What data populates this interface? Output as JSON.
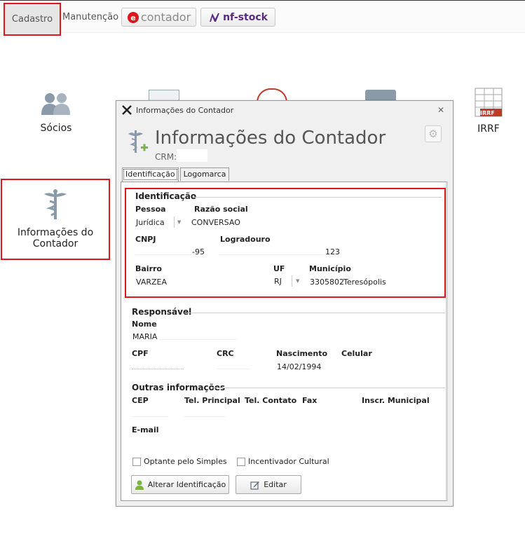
{
  "topbar": {
    "menu_cadastro": "Cadastro",
    "menu_manutencao": "Manutenção",
    "contador_logo_text": "contador",
    "nfstock_logo_text": "nf-stock"
  },
  "tiles": {
    "socios": "Sócios",
    "irrf": "IRRF",
    "irrf_badge": "IRRF",
    "info_line1": "Informações do",
    "info_line2": "Contador"
  },
  "dialog": {
    "window_title": "Informações do Contador",
    "heading": "Informações do Contador",
    "crm_label": "CRM:",
    "tabs": [
      "Identificação",
      "Logomarca"
    ],
    "identificacao": {
      "section": "Identificação",
      "pessoa_label": "Pessoa",
      "pessoa_value": "Jurídica",
      "razao_label": "Razão social",
      "razao_value": "CONVERSAO",
      "cnpj_label": "CNPJ",
      "cnpj_suffix": "-95",
      "logradouro_label": "Logradouro",
      "numero_value": "123",
      "bairro_label": "Bairro",
      "bairro_value": "VARZEA",
      "uf_label": "UF",
      "uf_value": "RJ",
      "municipio_label": "Município",
      "municipio_code": "3305802",
      "municipio_name": "Teresópolis"
    },
    "responsavel": {
      "section": "Responsável",
      "nome_label": "Nome",
      "nome_value": "MARIA",
      "cpf_label": "CPF",
      "crc_label": "CRC",
      "nascimento_label": "Nascimento",
      "nascimento_value": "14/02/1994",
      "celular_label": "Celular"
    },
    "outras": {
      "section": "Outras informações",
      "cep_label": "CEP",
      "tel_principal_label": "Tel. Principal",
      "tel_contato_label": "Tel. Contato",
      "fax_label": "Fax",
      "inscr_label": "Inscr. Municipal",
      "email_label": "E-mail"
    },
    "checkboxes": {
      "simples": "Optante pelo Simples",
      "cultural": "Incentivador Cultural"
    },
    "buttons": {
      "alterar": "Alterar Identificação",
      "editar": "Editar"
    }
  },
  "colors": {
    "highlight_red": "#e0161b",
    "contador_red": "#e0161b",
    "nfstock_purple": "#5a2a82",
    "alterar_icon_green": "#7cb342"
  }
}
